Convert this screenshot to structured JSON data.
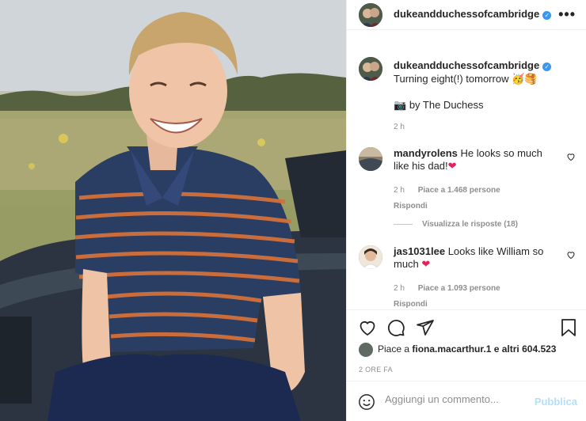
{
  "post": {
    "username": "dukeandduchessofcambridge",
    "verified_mark": "✓",
    "more_icon": "•••",
    "caption_line1": "Turning eight(!) tomorrow",
    "caption_emojis": "🥳🥞",
    "caption_camera": "📷",
    "caption_line2": "by The Duchess",
    "caption_time": "2 h"
  },
  "comments": [
    {
      "username": "mandyrolens",
      "text": "He looks so much like his dad!",
      "emoji": "❤",
      "time": "2 h",
      "likes": "Piace a 1.468 persone",
      "reply": "Rispondi"
    },
    {
      "username": "jas1031lee",
      "text": "Looks like William so much",
      "emoji": "❤",
      "time": "2 h",
      "likes": "Piace a 1.093 persone",
      "reply": "Rispondi"
    }
  ],
  "view_replies": "Visualizza le risposte (18)",
  "likes_summary": {
    "prefix": "Piace a",
    "user": "fiona.macarthur.1",
    "suffix": "e altri 604.523"
  },
  "time_ago": "2 ORE FA",
  "add_comment": {
    "emoji_icon": "☺",
    "placeholder": "Aggiungi un commento...",
    "post_label": "Pubblica"
  },
  "icons": [
    "heart-icon",
    "comment-icon",
    "share-icon",
    "bookmark-icon",
    "more-options-icon",
    "verified-icon",
    "emoji-icon"
  ],
  "colors": {
    "accent": "#3897f0",
    "heart_red": "#e0245e",
    "post_disabled": "#b2dffc",
    "muted": "#8e8e8e"
  }
}
